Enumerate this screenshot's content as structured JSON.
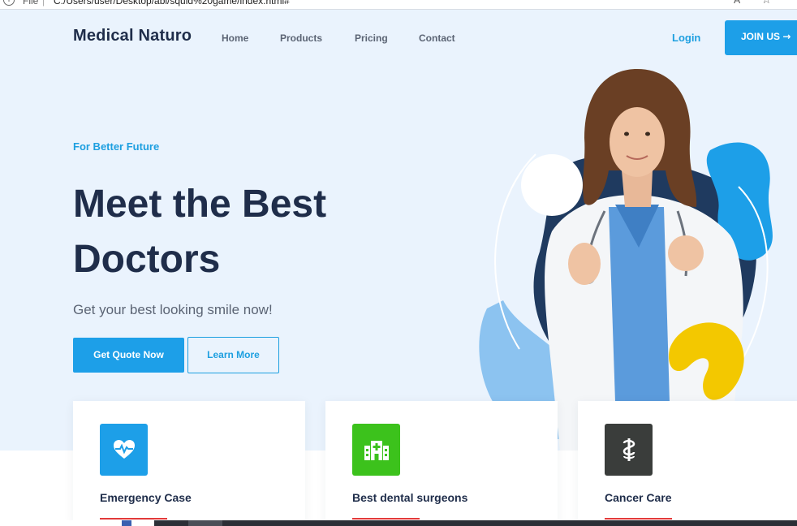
{
  "browser": {
    "info_icon": "info-icon",
    "scheme": "File",
    "separator": "|",
    "url": "C:/Users/user/Desktop/abi/squid%20game/index.html#",
    "zoom_icon": "zoom-icon",
    "star_icon": "star-icon"
  },
  "nav": {
    "logo": "Medical Naturo",
    "links": [
      "Home",
      "Products",
      "Pricing",
      "Contact"
    ],
    "login": "Login",
    "join": "JOIN US",
    "join_arrow": "→"
  },
  "hero": {
    "eyebrow": "For Better Future",
    "title_line1": "Meet the Best",
    "title_line2": "Doctors",
    "subtitle": "Get your best looking smile now!",
    "primary_button": "Get Quote Now",
    "secondary_button": "Learn More"
  },
  "cards": [
    {
      "title": "Emergency Case",
      "icon": "heartbeat-icon",
      "color": "#1d9fe8"
    },
    {
      "title": "Best dental surgeons",
      "icon": "hospital-icon",
      "color": "#3cc21c"
    },
    {
      "title": "Cancer Care",
      "icon": "medical-symbol-icon",
      "color": "#3a3d3b"
    }
  ],
  "colors": {
    "accent": "#1d9fe8",
    "heading": "#1f2d4a",
    "background": "#eaf3fd",
    "underline": "#e23a3a"
  }
}
